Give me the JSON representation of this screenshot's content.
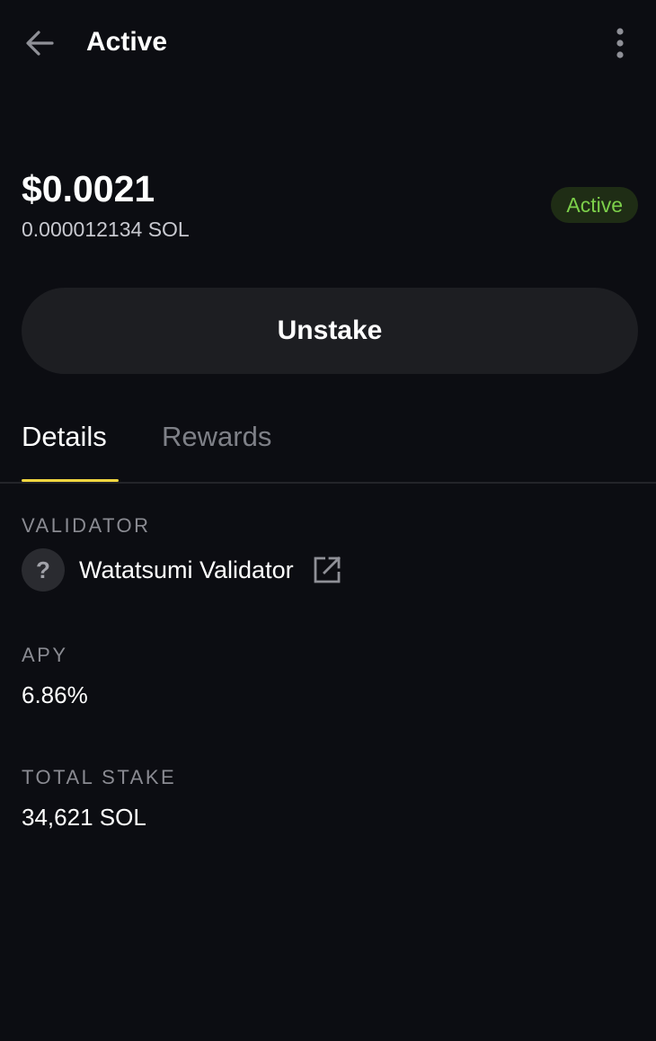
{
  "header": {
    "title": "Active",
    "back_icon": "arrow-left-icon",
    "menu_icon": "more-vertical-icon"
  },
  "balance": {
    "usd": "$0.0021",
    "sol": "0.000012134 SOL"
  },
  "status": {
    "label": "Active",
    "color": "#7ccf4a"
  },
  "actions": {
    "unstake_label": "Unstake"
  },
  "tabs": [
    {
      "label": "Details",
      "selected": true
    },
    {
      "label": "Rewards",
      "selected": false
    }
  ],
  "tab_indicator_color": "#f2d640",
  "details": {
    "validator": {
      "label": "VALIDATOR",
      "avatar_glyph": "?",
      "name": "Watatsumi Validator",
      "link_icon": "external-link-icon"
    },
    "apy": {
      "label": "APY",
      "value": "6.86%"
    },
    "total_stake": {
      "label": "TOTAL STAKE",
      "value": "34,621 SOL"
    }
  }
}
